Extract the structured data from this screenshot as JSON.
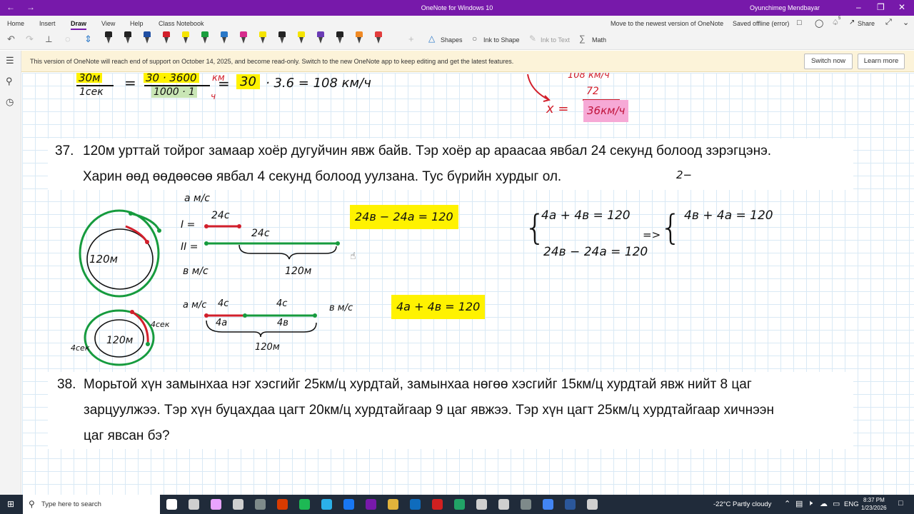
{
  "window": {
    "title": "OneNote for Windows 10",
    "user": "Oyunchimeg Mendbayar"
  },
  "menu": {
    "tabs": [
      "Home",
      "Insert",
      "Draw",
      "View",
      "Help",
      "Class Notebook"
    ],
    "move_link": "Move to the newest version of OneNote",
    "saved_status": "Saved offline (error)",
    "share": "Share",
    "notif_count": "5"
  },
  "toolbar": {
    "shapes": "Shapes",
    "ink_to_shape": "Ink to Shape",
    "ink_to_text": "Ink to Text",
    "math": "Math",
    "pen_colors": [
      "#222222",
      "#222222",
      "#1f4fa3",
      "#d21f2b",
      "#f5e400",
      "#1b9e3e",
      "#2a78c8",
      "#d62c8c",
      "#f5e400",
      "#222222",
      "#f5e400",
      "#6a3bb5",
      "#222222",
      "#f08a24",
      "#e23c3c"
    ]
  },
  "notice": {
    "message": "This version of OneNote will reach end of support on October 14, 2025, and become read-only. Switch to the new OneNote app to keep editing and get the latest features.",
    "switch_now": "Switch now",
    "learn_more": "Learn more"
  },
  "note": {
    "top_ink": {
      "frac1_num": "30м",
      "frac1_den": "1сек",
      "frac2_num": "30 · 3600",
      "frac2_den": "1000 · 1",
      "frac2_unit": "км",
      "frac2_unit_den": "ч",
      "result_box": "30",
      "result_rest": "· 3.6 = 108 км/ч",
      "right_line1": "108 км/ч",
      "right_line2": "72",
      "right_x": "x =",
      "right_result": "36км/ч"
    },
    "problem37": {
      "number": "37.",
      "line1": "120м урттай тойрог замаар хоёр дугуйчин явж байв. Тэр хоёр ар араасаа явбал 24 секунд болоод зэрэгцэнэ.",
      "line2": "Харин өөд өөдөөсөө явбал 4 секунд болоод уулзана. Тус бүрийн хурдыг ол."
    },
    "problem38": {
      "number": "38.",
      "line1": "Морьтой хүн замынхаа нэг хэсгийг 25км/ц хурдтай, замынхаа нөгөө хэсгийг 15км/ц хурдтай явж нийт 8 цаг",
      "line2": "зарцуулжээ. Тэр хүн буцахдаа цагт 20км/ц хурдтайгаар 9 цаг явжээ. Тэр хүн цагт 25км/ц хурдтайгаар хичнээн",
      "line3": "цаг явсан бэ?"
    },
    "ink37": {
      "circle1": "120м",
      "circle2": "120м",
      "speed_a": "а м/с",
      "speed_b": "в м/с",
      "marker_I": "I =",
      "marker_II": "II =",
      "t24a": "24с",
      "t24b": "24с",
      "dist120a": "120м",
      "eq_box1": "24в − 24а = 120",
      "speed_a2": "а м/с",
      "t4a": "4с",
      "t4b": "4с",
      "speed_b2": "в м/с",
      "seg_4a": "4а",
      "seg_4b": "4в",
      "dist120b": "120м",
      "t4c": "4сек",
      "t4d": "4сек",
      "eq_box2": "4а + 4в = 120",
      "sys1": "4а + 4в = 120",
      "sys2": "24в − 24а = 120",
      "arrow": "=>",
      "sys3": "4в + 4а = 120",
      "side_note": "2−"
    }
  },
  "taskbar": {
    "search_placeholder": "Type here to search",
    "weather": "-22°C  Partly cloudy",
    "lang": "ENG",
    "time": "8:37 PM",
    "date": "1/23/2026"
  }
}
